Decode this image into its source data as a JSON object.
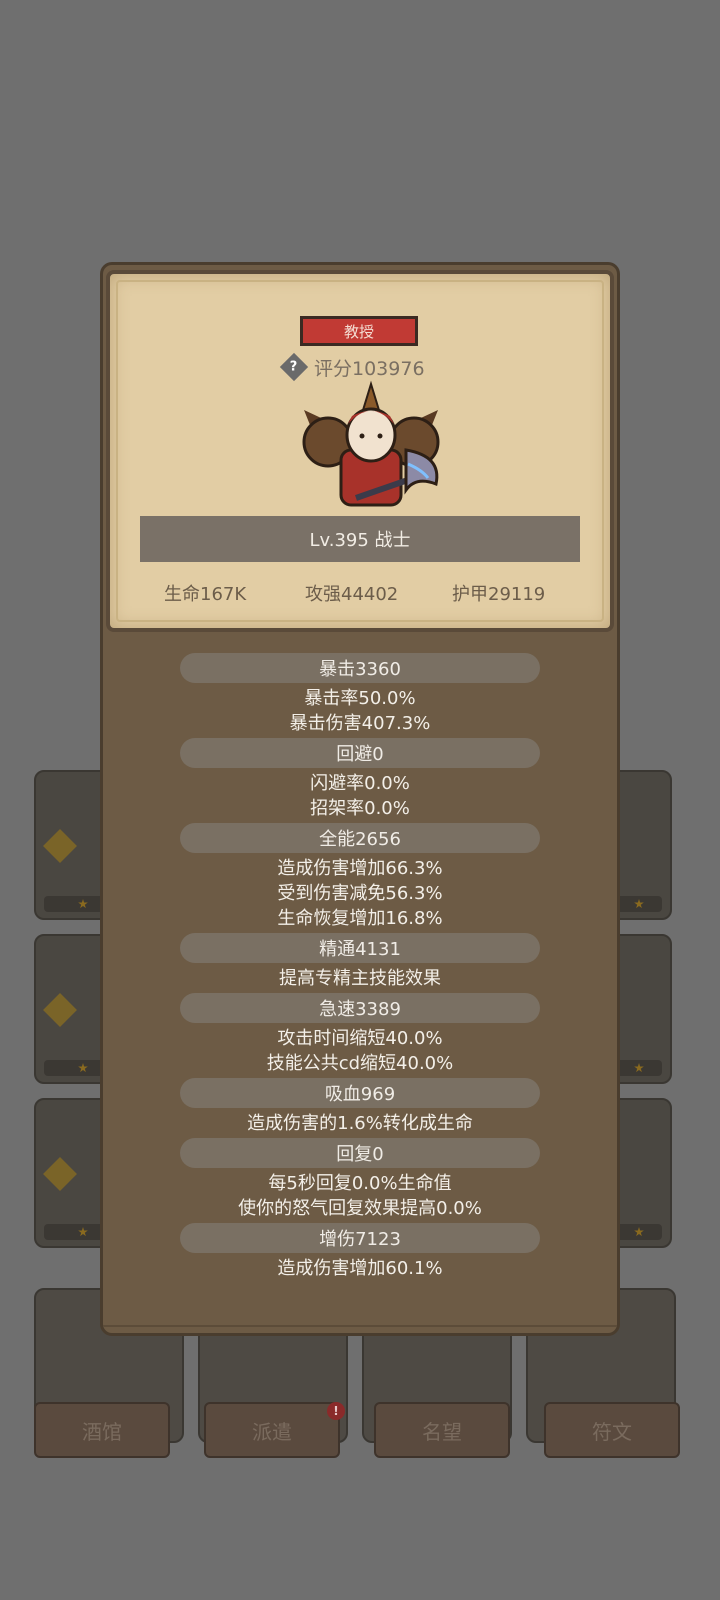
{
  "popup": {
    "rank_badge": "教授",
    "score_label": "评分103976",
    "level_label": "Lv.395 战士",
    "base_stats": [
      "生命167K",
      "攻强44402",
      "护甲29119"
    ]
  },
  "stat_groups": [
    {
      "title": "暴击3360",
      "lines": [
        "暴击率50.0%",
        "暴击伤害407.3%"
      ]
    },
    {
      "title": "回避0",
      "lines": [
        "闪避率0.0%",
        "招架率0.0%"
      ]
    },
    {
      "title": "全能2656",
      "lines": [
        "造成伤害增加66.3%",
        "受到伤害减免56.3%",
        "生命恢复增加16.8%"
      ]
    },
    {
      "title": "精通4131",
      "lines": [
        "提高专精主技能效果"
      ]
    },
    {
      "title": "急速3389",
      "lines": [
        "攻击时间缩短40.0%",
        "技能公共cd缩短40.0%"
      ]
    },
    {
      "title": "吸血969",
      "lines": [
        "造成伤害的1.6%转化成生命"
      ]
    },
    {
      "title": "回复0",
      "lines": [
        "每5秒回复0.0%生命值",
        "使你的怒气回复效果提高0.0%"
      ]
    },
    {
      "title": "增伤7123",
      "lines": [
        "造成伤害增加60.1%"
      ]
    }
  ],
  "background_nav": [
    {
      "label": "酒馆"
    },
    {
      "label": "派遣",
      "alert": "!"
    },
    {
      "label": "名望"
    },
    {
      "label": "符文"
    }
  ],
  "colors": {
    "panel": "#6d5b45",
    "card": "#e2cda4",
    "badge": "#c13a34",
    "stat_pill": "#7a7063"
  }
}
